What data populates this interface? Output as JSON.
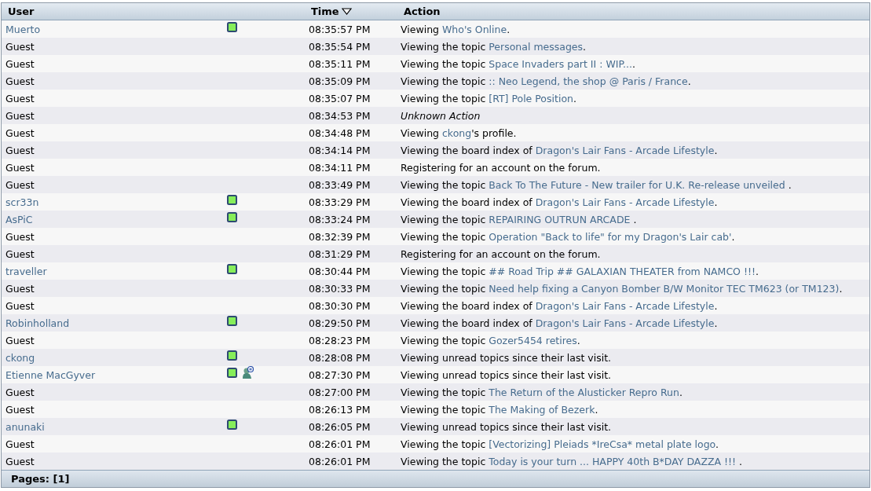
{
  "table": {
    "columns": [
      {
        "label": "User"
      },
      {},
      {
        "label": "Time",
        "sorted": true
      },
      {
        "label": "Action"
      }
    ],
    "rows": [
      {
        "user": "Muerto",
        "kind": "member",
        "online": true,
        "messenger": false,
        "time": "08:35:57 PM",
        "action": {
          "kind": "link",
          "text": "Viewing ",
          "link": "Who's Online",
          "after": "."
        }
      },
      {
        "user": "Guest",
        "kind": "guest",
        "online": false,
        "messenger": false,
        "time": "08:35:54 PM",
        "action": {
          "kind": "link",
          "text": "Viewing the topic ",
          "link": "Personal messages",
          "after": "."
        }
      },
      {
        "user": "Guest",
        "kind": "guest",
        "online": false,
        "messenger": false,
        "time": "08:35:11 PM",
        "action": {
          "kind": "link",
          "text": "Viewing the topic ",
          "link": "Space Invaders part II : WIP...",
          "after": "."
        }
      },
      {
        "user": "Guest",
        "kind": "guest",
        "online": false,
        "messenger": false,
        "time": "08:35:09 PM",
        "action": {
          "kind": "link",
          "text": "Viewing the topic ",
          "link": ":: Neo Legend, the shop @ Paris / France",
          "after": "."
        }
      },
      {
        "user": "Guest",
        "kind": "guest",
        "online": false,
        "messenger": false,
        "time": "08:35:07 PM",
        "action": {
          "kind": "link",
          "text": "Viewing the topic ",
          "link": "[RT] Pole Position",
          "after": "."
        }
      },
      {
        "user": "Guest",
        "kind": "guest",
        "online": false,
        "messenger": false,
        "time": "08:34:53 PM",
        "action": {
          "kind": "unknown",
          "text": "Unknown Action"
        }
      },
      {
        "user": "Guest",
        "kind": "guest",
        "online": false,
        "messenger": false,
        "time": "08:34:48 PM",
        "action": {
          "kind": "link",
          "text": "Viewing ",
          "link": "ckong",
          "after": "'s profile."
        }
      },
      {
        "user": "Guest",
        "kind": "guest",
        "online": false,
        "messenger": false,
        "time": "08:34:14 PM",
        "action": {
          "kind": "link",
          "text": "Viewing the board index of ",
          "link": "Dragon's Lair Fans - Arcade Lifestyle",
          "after": "."
        }
      },
      {
        "user": "Guest",
        "kind": "guest",
        "online": false,
        "messenger": false,
        "time": "08:34:11 PM",
        "action": {
          "kind": "plain",
          "text": "Registering for an account on the forum."
        }
      },
      {
        "user": "Guest",
        "kind": "guest",
        "online": false,
        "messenger": false,
        "time": "08:33:49 PM",
        "action": {
          "kind": "link",
          "text": "Viewing the topic ",
          "link": "Back To The Future - New trailer for U.K. Re-release unveiled",
          "after": " ."
        }
      },
      {
        "user": "scr33n",
        "kind": "member",
        "online": true,
        "messenger": false,
        "time": "08:33:29 PM",
        "action": {
          "kind": "link",
          "text": "Viewing the board index of ",
          "link": "Dragon's Lair Fans - Arcade Lifestyle",
          "after": "."
        }
      },
      {
        "user": "AsPiC",
        "kind": "member",
        "online": true,
        "messenger": false,
        "time": "08:33:24 PM",
        "action": {
          "kind": "link",
          "text": "Viewing the topic ",
          "link": "REPAIRING OUTRUN ARCADE",
          "after": " ."
        }
      },
      {
        "user": "Guest",
        "kind": "guest",
        "online": false,
        "messenger": false,
        "time": "08:32:39 PM",
        "action": {
          "kind": "link",
          "text": "Viewing the topic ",
          "link": "Operation \"Back to life\" for my Dragon's Lair cab'",
          "after": "."
        }
      },
      {
        "user": "Guest",
        "kind": "guest",
        "online": false,
        "messenger": false,
        "time": "08:31:29 PM",
        "action": {
          "kind": "plain",
          "text": "Registering for an account on the forum."
        }
      },
      {
        "user": "traveller",
        "kind": "member",
        "online": true,
        "messenger": false,
        "time": "08:30:44 PM",
        "action": {
          "kind": "link",
          "text": "Viewing the topic ",
          "link": "## Road Trip ## GALAXIAN THEATER from NAMCO !!!",
          "after": "."
        }
      },
      {
        "user": "Guest",
        "kind": "guest",
        "online": false,
        "messenger": false,
        "time": "08:30:33 PM",
        "action": {
          "kind": "link",
          "text": "Viewing the topic ",
          "link": "Need help fixing a Canyon Bomber B/W Monitor TEC TM623 (or TM123)",
          "after": "."
        }
      },
      {
        "user": "Guest",
        "kind": "guest",
        "online": false,
        "messenger": false,
        "time": "08:30:30 PM",
        "action": {
          "kind": "link",
          "text": "Viewing the board index of ",
          "link": "Dragon's Lair Fans - Arcade Lifestyle",
          "after": "."
        }
      },
      {
        "user": "Robinholland",
        "kind": "member",
        "online": true,
        "messenger": false,
        "time": "08:29:50 PM",
        "action": {
          "kind": "link",
          "text": "Viewing the board index of ",
          "link": "Dragon's Lair Fans - Arcade Lifestyle",
          "after": "."
        }
      },
      {
        "user": "Guest",
        "kind": "guest",
        "online": false,
        "messenger": false,
        "time": "08:28:23 PM",
        "action": {
          "kind": "link",
          "text": "Viewing the topic ",
          "link": "Gozer5454 retires",
          "after": "."
        }
      },
      {
        "user": "ckong",
        "kind": "member",
        "online": true,
        "messenger": false,
        "time": "08:28:08 PM",
        "action": {
          "kind": "plain",
          "text": "Viewing unread topics since their last visit."
        }
      },
      {
        "user": "Etienne MacGyver",
        "kind": "member",
        "online": true,
        "messenger": true,
        "time": "08:27:30 PM",
        "action": {
          "kind": "plain",
          "text": "Viewing unread topics since their last visit."
        }
      },
      {
        "user": "Guest",
        "kind": "guest",
        "online": false,
        "messenger": false,
        "time": "08:27:00 PM",
        "action": {
          "kind": "link",
          "text": "Viewing the topic ",
          "link": "The Return of the Alusticker Repro Run",
          "after": "."
        }
      },
      {
        "user": "Guest",
        "kind": "guest",
        "online": false,
        "messenger": false,
        "time": "08:26:13 PM",
        "action": {
          "kind": "link",
          "text": "Viewing the topic ",
          "link": "The Making of Bezerk",
          "after": "."
        }
      },
      {
        "user": "anunaki",
        "kind": "member",
        "online": true,
        "messenger": false,
        "time": "08:26:05 PM",
        "action": {
          "kind": "plain",
          "text": "Viewing unread topics since their last visit."
        }
      },
      {
        "user": "Guest",
        "kind": "guest",
        "online": false,
        "messenger": false,
        "time": "08:26:01 PM",
        "action": {
          "kind": "link",
          "text": "Viewing the topic ",
          "link": "[Vectorizing] Pleiads *IreCsa* metal plate logo",
          "after": "."
        }
      },
      {
        "user": "Guest",
        "kind": "guest",
        "online": false,
        "messenger": false,
        "time": "08:26:01 PM",
        "action": {
          "kind": "link",
          "text": "Viewing the topic ",
          "link": "Today is your turn ... HAPPY 40th B*DAY DAZZA !!!",
          "after": " ."
        }
      }
    ]
  },
  "footer": {
    "pages": "Pages: [1]"
  }
}
